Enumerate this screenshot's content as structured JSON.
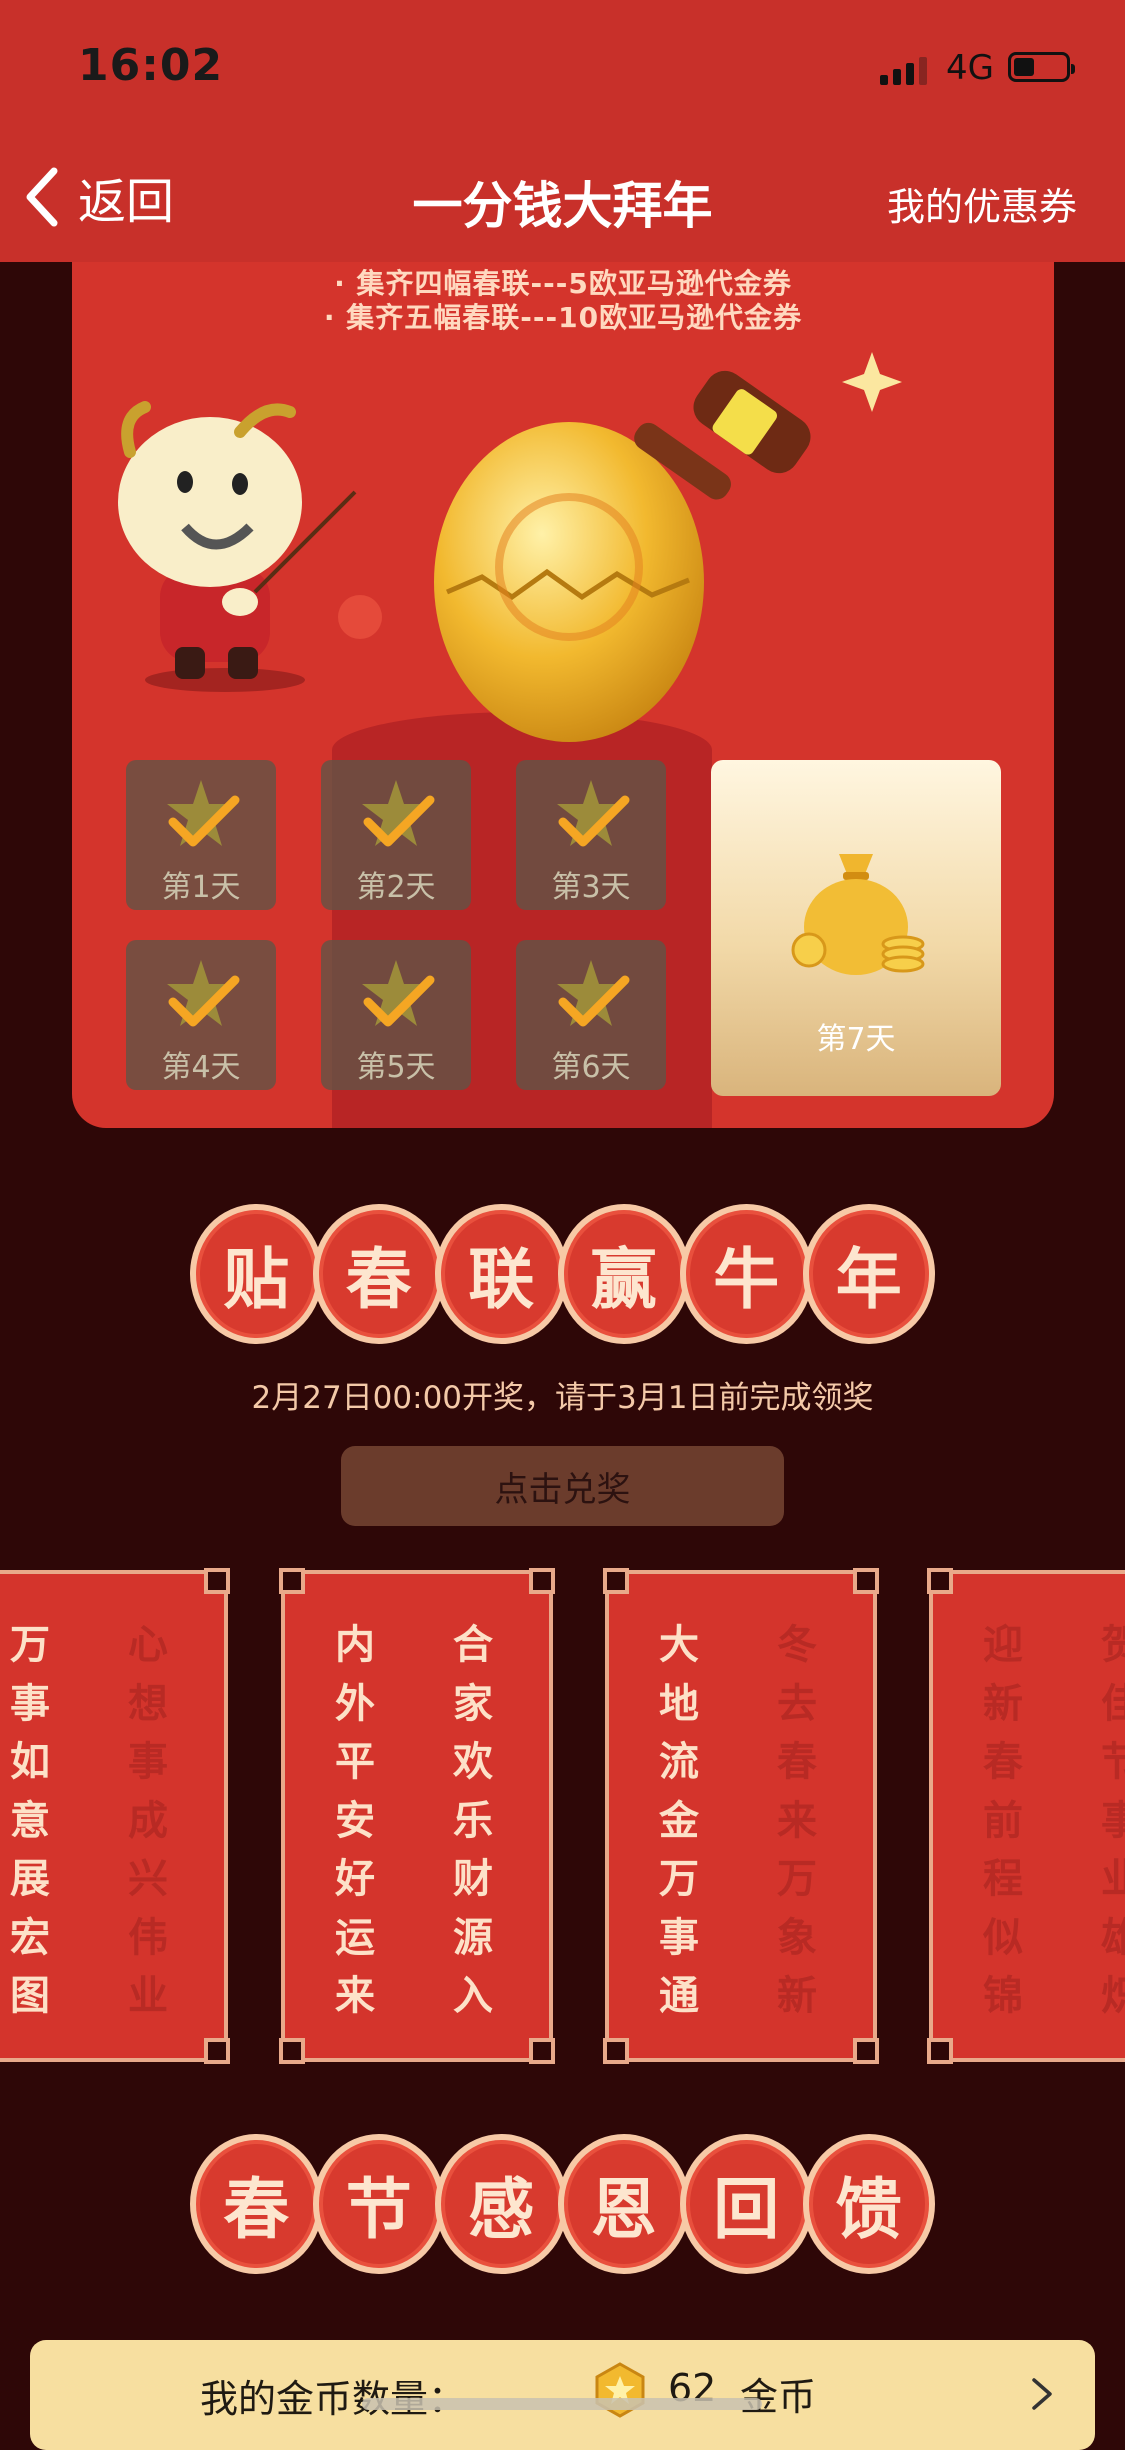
{
  "status_bar": {
    "time": "16:02",
    "network": "4G"
  },
  "nav": {
    "back_label": "返回",
    "title": "一分钱大拜年",
    "right_link": "我的优惠券"
  },
  "rules": [
    "· 集齐四幅春联---5欧亚马逊代金券",
    "· 集齐五幅春联---10欧亚马逊代金券"
  ],
  "days": [
    "第1天",
    "第2天",
    "第3天",
    "第4天",
    "第5天",
    "第6天"
  ],
  "day7": "第7天",
  "section1_chars": [
    "贴",
    "春",
    "联",
    "赢",
    "牛",
    "年"
  ],
  "notice": "2月27日00:00开奖，请于3月1日前完成领奖",
  "redeem_button": "点击兑奖",
  "couplets": [
    {
      "left": [
        "万",
        "事",
        "如",
        "意",
        "展",
        "宏",
        "图"
      ],
      "right": [
        "心",
        "想",
        "事",
        "成",
        "兴",
        "伟",
        "业"
      ]
    },
    {
      "left": [
        "内",
        "外",
        "平",
        "安",
        "好",
        "运",
        "来"
      ],
      "right": [
        "合",
        "家",
        "欢",
        "乐",
        "财",
        "源",
        "入"
      ]
    },
    {
      "left": [
        "大",
        "地",
        "流",
        "金",
        "万",
        "事",
        "通"
      ],
      "right": [
        "冬",
        "去",
        "春",
        "来",
        "万",
        "象",
        "新"
      ]
    },
    {
      "left": [
        "迎",
        "新",
        "春",
        "前",
        "程",
        "似",
        "锦"
      ],
      "right": [
        "贺",
        "佳",
        "节",
        "事",
        "业",
        "雄",
        "炽"
      ]
    }
  ],
  "section2_chars": [
    "春",
    "节",
    "感",
    "恩",
    "回",
    "馈"
  ],
  "coins": {
    "label": "我的金币数量：",
    "count": "62",
    "unit": "金币"
  },
  "colors": {
    "header_red": "#c8302a",
    "background": "#2e0707",
    "card_red": "#d4342c",
    "coin_bar": "#f7dfa0"
  }
}
